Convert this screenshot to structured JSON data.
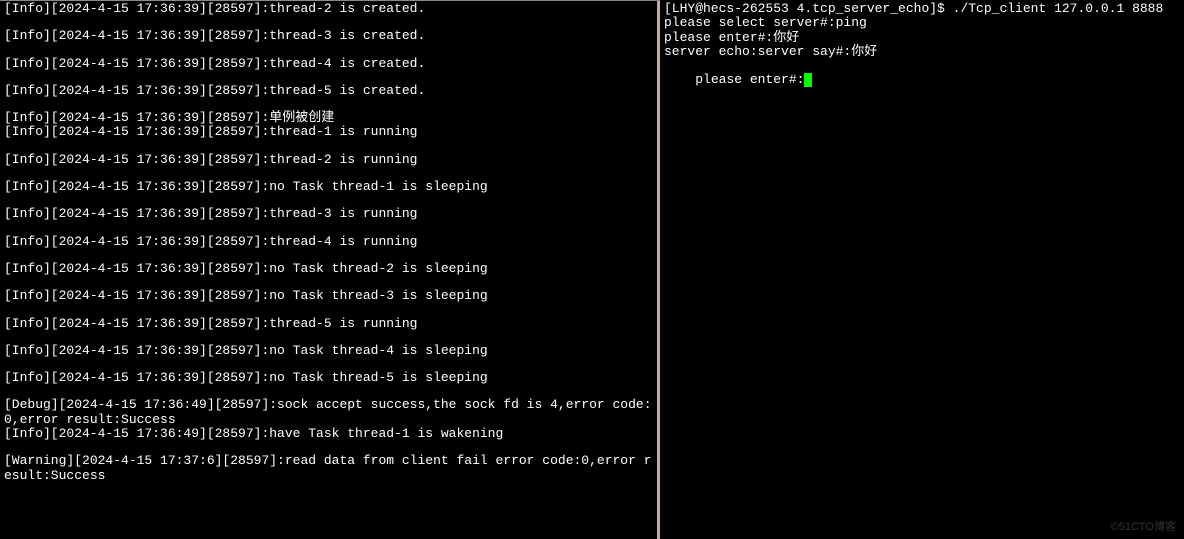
{
  "leftPane": {
    "lines": [
      {
        "text": "[Info][2024-4-15 17:36:39][28597]:thread-2 is created.",
        "spaced": true
      },
      {
        "text": "[Info][2024-4-15 17:36:39][28597]:thread-3 is created.",
        "spaced": true
      },
      {
        "text": "[Info][2024-4-15 17:36:39][28597]:thread-4 is created.",
        "spaced": true
      },
      {
        "text": "[Info][2024-4-15 17:36:39][28597]:thread-5 is created.",
        "spaced": true
      },
      {
        "text": "[Info][2024-4-15 17:36:39][28597]:单例被创建",
        "spaced": false
      },
      {
        "text": "[Info][2024-4-15 17:36:39][28597]:thread-1 is running",
        "spaced": true
      },
      {
        "text": "[Info][2024-4-15 17:36:39][28597]:thread-2 is running",
        "spaced": true
      },
      {
        "text": "[Info][2024-4-15 17:36:39][28597]:no Task thread-1 is sleeping",
        "spaced": true
      },
      {
        "text": "[Info][2024-4-15 17:36:39][28597]:thread-3 is running",
        "spaced": true
      },
      {
        "text": "[Info][2024-4-15 17:36:39][28597]:thread-4 is running",
        "spaced": true
      },
      {
        "text": "[Info][2024-4-15 17:36:39][28597]:no Task thread-2 is sleeping",
        "spaced": true
      },
      {
        "text": "[Info][2024-4-15 17:36:39][28597]:no Task thread-3 is sleeping",
        "spaced": true
      },
      {
        "text": "[Info][2024-4-15 17:36:39][28597]:thread-5 is running",
        "spaced": true
      },
      {
        "text": "[Info][2024-4-15 17:36:39][28597]:no Task thread-4 is sleeping",
        "spaced": true
      },
      {
        "text": "[Info][2024-4-15 17:36:39][28597]:no Task thread-5 is sleeping",
        "spaced": true
      },
      {
        "text": "[Debug][2024-4-15 17:36:49][28597]:sock accept success,the sock fd is 4,error code:0,error result:Success",
        "spaced": false
      },
      {
        "text": "[Info][2024-4-15 17:36:49][28597]:have Task thread-1 is wakening",
        "spaced": true
      },
      {
        "text": "[Warning][2024-4-15 17:37:6][28597]:read data from client fail error code:0,error result:Success",
        "spaced": false
      }
    ]
  },
  "rightPane": {
    "promptLine": "[LHY@hecs-262553 4.tcp_server_echo]$ ./Tcp_client 127.0.0.1 8888",
    "lines": [
      "please select server#:ping",
      "please enter#:你好",
      "server echo:server say#:你好",
      "please enter#:"
    ]
  },
  "watermark": "©51CTO博客"
}
